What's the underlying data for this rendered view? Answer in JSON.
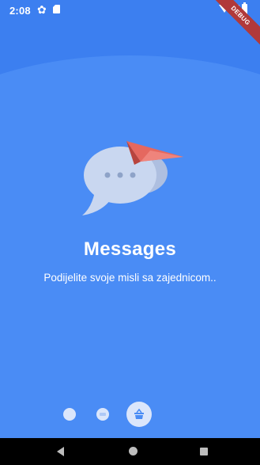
{
  "status_bar": {
    "time": "2:08",
    "icons": [
      "gear-icon",
      "sd-card-icon",
      "wifi-icon",
      "signal-icon",
      "battery-icon"
    ]
  },
  "debug_ribbon": "DEBUG",
  "onboarding": {
    "title": "Messages",
    "subtitle": "Podijelite svoje misli sa zajednicom..",
    "illustration": "chat-bubble-with-paper-plane",
    "page_indicator": {
      "count": 3,
      "active": 3,
      "dot_icons": [
        "",
        "",
        "basket-icon"
      ]
    }
  },
  "nav_bar": {
    "buttons": [
      "back-icon",
      "home-icon",
      "recents-icon"
    ]
  },
  "colors": {
    "background": "#4a8cf5",
    "header": "#3c7ff0",
    "accent_plane": "#e5685f",
    "bubble": "#c9d7f0",
    "ribbon": "#b1393a"
  }
}
